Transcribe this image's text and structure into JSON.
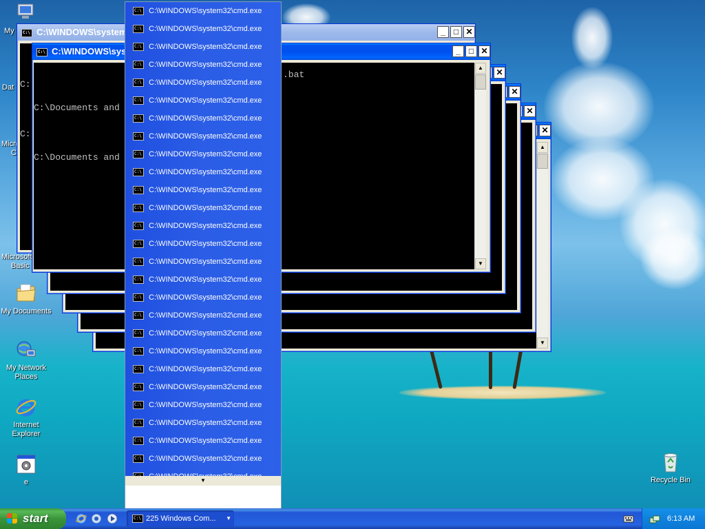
{
  "desktop": {
    "icons": [
      {
        "label": "My Documents"
      },
      {
        "label": "My Network Places"
      },
      {
        "label": "Internet Explorer"
      },
      {
        "label": "e"
      },
      {
        "label": "Recycle Bin"
      }
    ],
    "partial_labels": [
      "My",
      "Dat",
      "Micro",
      "C",
      "Microsoft",
      "Basic"
    ]
  },
  "windows": {
    "back_title": "C:\\WINDOWS\\system",
    "front_title": "C:\\WINDOWS\\syst",
    "back_console_lines": [
      "C:",
      "C:"
    ],
    "front_console_lines": [
      "C:\\Documents and",
      "C:\\Documents and"
    ],
    "front_console_fragment": ".bat",
    "minimize_glyph": "_",
    "maximize_glyph": "□",
    "close_glyph": "✕",
    "scroll_up_glyph": "▲",
    "scroll_down_glyph": "▼"
  },
  "group_menu": {
    "items": [
      "C:\\WINDOWS\\system32\\cmd.exe",
      "C:\\WINDOWS\\system32\\cmd.exe",
      "C:\\WINDOWS\\system32\\cmd.exe",
      "C:\\WINDOWS\\system32\\cmd.exe",
      "C:\\WINDOWS\\system32\\cmd.exe",
      "C:\\WINDOWS\\system32\\cmd.exe",
      "C:\\WINDOWS\\system32\\cmd.exe",
      "C:\\WINDOWS\\system32\\cmd.exe",
      "C:\\WINDOWS\\system32\\cmd.exe",
      "C:\\WINDOWS\\system32\\cmd.exe",
      "C:\\WINDOWS\\system32\\cmd.exe",
      "C:\\WINDOWS\\system32\\cmd.exe",
      "C:\\WINDOWS\\system32\\cmd.exe",
      "C:\\WINDOWS\\system32\\cmd.exe",
      "C:\\WINDOWS\\system32\\cmd.exe",
      "C:\\WINDOWS\\system32\\cmd.exe",
      "C:\\WINDOWS\\system32\\cmd.exe",
      "C:\\WINDOWS\\system32\\cmd.exe",
      "C:\\WINDOWS\\system32\\cmd.exe",
      "C:\\WINDOWS\\system32\\cmd.exe",
      "C:\\WINDOWS\\system32\\cmd.exe",
      "C:\\WINDOWS\\system32\\cmd.exe",
      "C:\\WINDOWS\\system32\\cmd.exe",
      "C:\\WINDOWS\\system32\\cmd.exe",
      "C:\\WINDOWS\\system32\\cmd.exe",
      "C:\\WINDOWS\\system32\\cmd.exe",
      "C:\\WINDOWS\\system32\\cmd.exe"
    ],
    "cut_off_item": "C:\\WINDOWS\\system32\\cmd.exe",
    "more_arrow": "▼"
  },
  "taskbar": {
    "start_label": "start",
    "group_button_label": "225 Windows Com...",
    "group_arrow": "▼",
    "clock": "6:13 AM"
  },
  "colors": {
    "menu_blue": "#2c60e8",
    "taskbar_blue": "#2663e0",
    "start_green": "#3a953a",
    "tray_blue": "#0f82de"
  }
}
